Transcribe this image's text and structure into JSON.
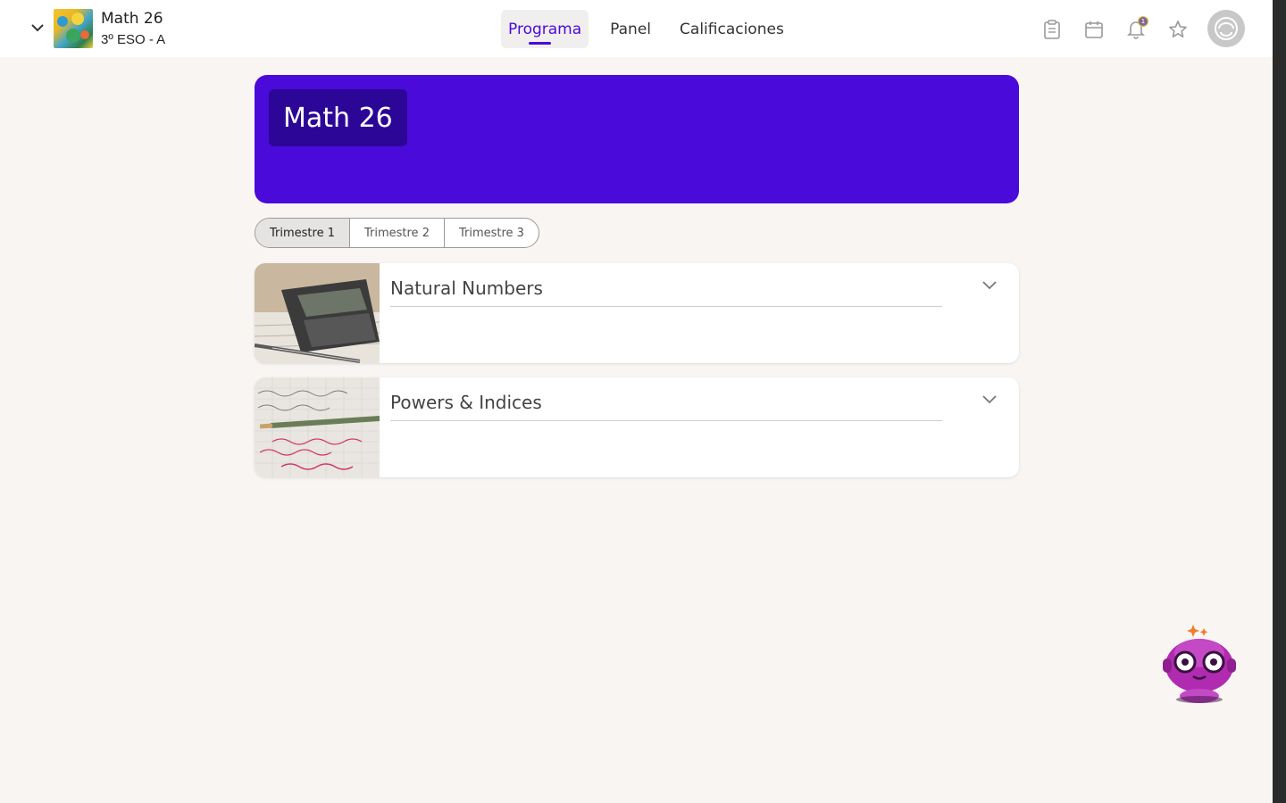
{
  "header": {
    "course_name": "Math 26",
    "course_group": "3º ESO - A",
    "nav": [
      {
        "label": "Programa",
        "active": true
      },
      {
        "label": "Panel",
        "active": false
      },
      {
        "label": "Calificaciones",
        "active": false
      }
    ],
    "icons": [
      "clipboard-icon",
      "calendar-icon",
      "bell-icon",
      "star-icon",
      "avatar-icon"
    ],
    "notification_count": "1"
  },
  "banner": {
    "title": "Math 26",
    "color": "#4a0ad9",
    "title_bg": "#2c0696"
  },
  "terms": [
    {
      "label": "Trimestre 1",
      "active": true
    },
    {
      "label": "Trimestre 2",
      "active": false
    },
    {
      "label": "Trimestre 3",
      "active": false
    }
  ],
  "units": [
    {
      "title": "Natural Numbers",
      "image": "calculator-photo"
    },
    {
      "title": "Powers & Indices",
      "image": "handwritten-math-photo"
    }
  ],
  "assistant": {
    "icon": "robot-assistant-icon"
  },
  "colors": {
    "accent": "#4a0ad9",
    "background": "#f8f5f3"
  }
}
